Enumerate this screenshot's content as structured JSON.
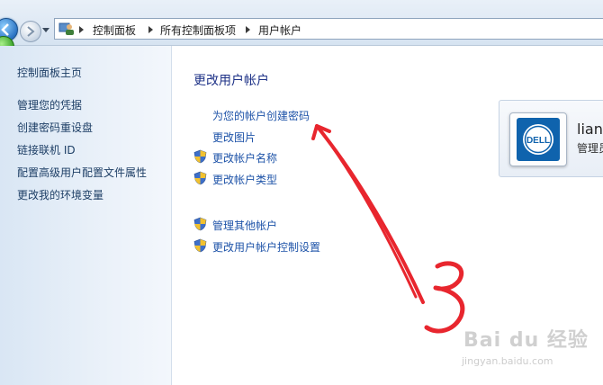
{
  "address_bar": {
    "crumbs": [
      "控制面板",
      "所有控制面板项",
      "用户帐户"
    ],
    "back_icon": "back-arrow-icon",
    "forward_icon": "forward-arrow-icon",
    "location_icon": "control-panel-users-icon"
  },
  "sidebar": {
    "home": "控制面板主页",
    "items": [
      {
        "label": "管理您的凭据"
      },
      {
        "label": "创建密码重设盘"
      },
      {
        "label": "链接联机 ID"
      },
      {
        "label": "配置高级用户配置文件属性"
      },
      {
        "label": "更改我的环境变量"
      }
    ]
  },
  "main": {
    "heading": "更改用户帐户",
    "tasks": [
      {
        "label": "为您的帐户创建密码",
        "shield": false
      },
      {
        "label": "更改图片",
        "shield": false
      },
      {
        "label": "更改帐户名称",
        "shield": true
      },
      {
        "label": "更改帐户类型",
        "shield": true
      }
    ],
    "other_tasks": [
      {
        "label": "管理其他帐户",
        "shield": true
      },
      {
        "label": "更改用户帐户控制设置",
        "shield": true
      }
    ]
  },
  "account": {
    "name": "lianç",
    "role": "管理员",
    "picture": "dell-logo-avatar",
    "picture_text": "DELL"
  },
  "annotation": {
    "text": "3",
    "color": "#e8262e"
  },
  "watermark": {
    "logo": "Bai du 经验",
    "url": "jingyan.baidu.com"
  },
  "colors": {
    "link": "#1e53a8",
    "heading": "#1e3287",
    "sidebar_bg": "#dfe9f5"
  }
}
